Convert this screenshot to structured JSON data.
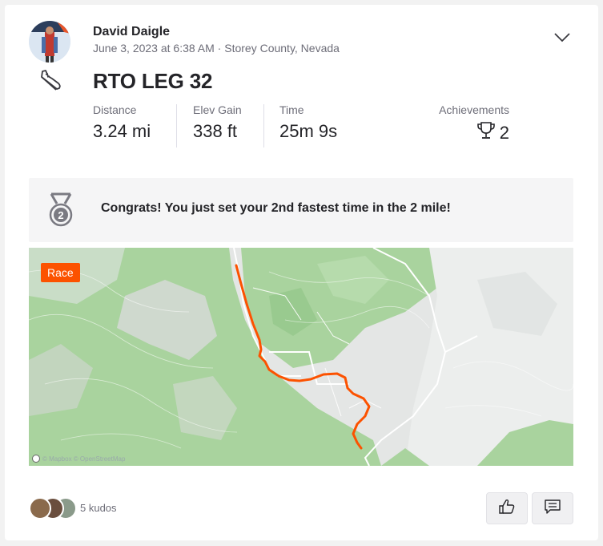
{
  "athlete": {
    "name": "David Daigle",
    "date": "June 3, 2023 at 6:38 AM",
    "separator": "·",
    "location": "Storey County, Nevada"
  },
  "activity": {
    "title": "RTO LEG 32",
    "sport_icon": "running-shoe-icon"
  },
  "stats": [
    {
      "label": "Distance",
      "value": "3.24 mi"
    },
    {
      "label": "Elev Gain",
      "value": "338 ft"
    },
    {
      "label": "Time",
      "value": "25m 9s"
    }
  ],
  "achievements": {
    "label": "Achievements",
    "count": "2",
    "icon": "trophy-icon"
  },
  "banner": {
    "text": "Congrats! You just set your 2nd fastest time in the 2 mile!",
    "icon": "medal-2-icon",
    "medal_number": "2"
  },
  "map": {
    "badge": "Race",
    "attribution": "© Mapbox © OpenStreetMap"
  },
  "kudos": {
    "text": "5 kudos"
  },
  "actions": {
    "kudos_icon": "thumbs-up-icon",
    "comment_icon": "comment-icon"
  },
  "colors": {
    "accent": "#fc5200",
    "route": "#fc5200",
    "map_green": "#a9d39e"
  }
}
